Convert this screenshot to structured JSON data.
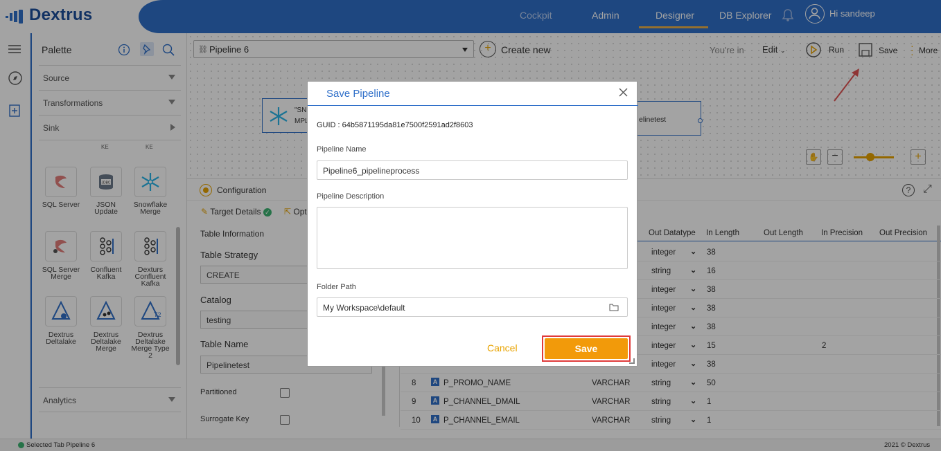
{
  "app": {
    "logo": "Dextrus"
  },
  "nav": {
    "items": [
      "Cockpit",
      "Admin",
      "Designer",
      "DB Explorer"
    ],
    "greeting": "Hi sandeep"
  },
  "palette": {
    "title": "Palette",
    "sections": [
      "Source",
      "Transformations",
      "Sink"
    ],
    "partial_labels": [
      "KE",
      "KE"
    ],
    "tiles": [
      {
        "label": "SQL Server"
      },
      {
        "label": "JSON Update"
      },
      {
        "label": "Snowflake Merge"
      },
      {
        "label": "SQL Server Merge"
      },
      {
        "label": "Confluent Kafka"
      },
      {
        "label": "Dexturs Confluent Kafka"
      },
      {
        "label": "Dextrus Deltalake"
      },
      {
        "label": "Dextrus Deltalake Merge"
      },
      {
        "label": "Dextrus Deltalake Merge Type 2"
      }
    ],
    "analytics": "Analytics"
  },
  "toolbar": {
    "pipeline": "Pipeline 6",
    "create_new": "Create new",
    "youre_in": "You're in",
    "mode": "Edit",
    "run": "Run",
    "save": "Save",
    "more": "More"
  },
  "canvas": {
    "node_left_text_1": "\"SN",
    "node_left_text_2": "MPL",
    "node_right_text": "elinetest"
  },
  "config": {
    "tab": "Configuration",
    "subtab_target": "Target Details",
    "subtab_opt": "Opt",
    "table_info": "Table Information",
    "strategy_label": "Table Strategy",
    "strategy_value": "CREATE",
    "catalog_label": "Catalog",
    "catalog_value": "testing",
    "table_name_label": "Table Name",
    "table_name_value": "Pipelinetest",
    "partitioned": "Partitioned",
    "surrogate": "Surrogate Key"
  },
  "grid": {
    "headers": [
      "Out Datatype",
      "In Length",
      "Out Length",
      "In Precision",
      "Out Precision"
    ],
    "rows": [
      {
        "num": "",
        "name": "",
        "in_type": "",
        "out_type": "integer",
        "len": "38",
        "prec": ""
      },
      {
        "num": "",
        "name": "",
        "in_type": "",
        "out_type": "string",
        "len": "16",
        "prec": ""
      },
      {
        "num": "",
        "name": "",
        "in_type": "",
        "out_type": "integer",
        "len": "38",
        "prec": ""
      },
      {
        "num": "",
        "name": "",
        "in_type": "",
        "out_type": "integer",
        "len": "38",
        "prec": ""
      },
      {
        "num": "",
        "name": "",
        "in_type": "",
        "out_type": "integer",
        "len": "38",
        "prec": ""
      },
      {
        "num": "",
        "name": "",
        "in_type": "",
        "out_type": "integer",
        "len": "15",
        "prec": "2"
      },
      {
        "num": "",
        "name": "",
        "in_type": "",
        "out_type": "integer",
        "len": "38",
        "prec": ""
      },
      {
        "num": "8",
        "name": "P_PROMO_NAME",
        "in_type": "VARCHAR",
        "out_type": "string",
        "len": "50",
        "prec": ""
      },
      {
        "num": "9",
        "name": "P_CHANNEL_DMAIL",
        "in_type": "VARCHAR",
        "out_type": "string",
        "len": "1",
        "prec": ""
      },
      {
        "num": "10",
        "name": "P_CHANNEL_EMAIL",
        "in_type": "VARCHAR",
        "out_type": "string",
        "len": "1",
        "prec": ""
      }
    ]
  },
  "footer": {
    "status": "Selected Tab Pipeline 6",
    "copyright": "2021 © Dextrus"
  },
  "modal": {
    "title": "Save Pipeline",
    "guid": "GUID : 64b5871195da81e7500f2591ad2f8603",
    "name_label": "Pipeline Name",
    "name_value": "Pipeline6_pipelineprocess",
    "desc_label": "Pipeline Description",
    "desc_value": "",
    "folder_label": "Folder Path",
    "folder_value": "My Workspace\\default",
    "cancel": "Cancel",
    "save": "Save"
  },
  "colors": {
    "brand": "#2f6fc9",
    "accent": "#f29a0a",
    "highlight": "#e03a3a"
  }
}
